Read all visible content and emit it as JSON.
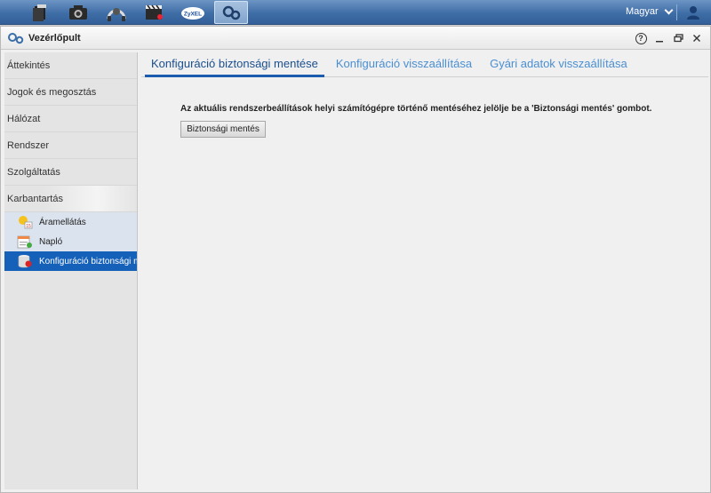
{
  "topbar": {
    "apps": [
      {
        "icon": "file-browser-icon"
      },
      {
        "icon": "photo-camera-icon"
      },
      {
        "icon": "music-icon"
      },
      {
        "icon": "video-icon"
      },
      {
        "icon": "zyxel-cloud-icon",
        "text": "ZyXEL"
      },
      {
        "icon": "control-panel-icon",
        "active": true
      }
    ],
    "language": "Magyar",
    "user_icon": "user-icon"
  },
  "window": {
    "title": "Vezérlőpult",
    "help_glyph": "?"
  },
  "sidebar": {
    "items": [
      {
        "label": "Áttekintés"
      },
      {
        "label": "Jogok és megosztás"
      },
      {
        "label": "Hálózat"
      },
      {
        "label": "Rendszer"
      },
      {
        "label": "Szolgáltatás"
      },
      {
        "label": "Karbantartás",
        "expanded": true
      }
    ],
    "sub_items": [
      {
        "label": "Áramellátás",
        "icon": "power-icon"
      },
      {
        "label": "Napló",
        "icon": "log-icon"
      },
      {
        "label": "Konfiguráció biztonsági mentése",
        "icon": "backup-database-icon",
        "selected": true
      }
    ]
  },
  "main": {
    "tabs": [
      {
        "label": "Konfiguráció biztonsági mentése",
        "active": true
      },
      {
        "label": "Konfiguráció visszaállítása"
      },
      {
        "label": "Gyári adatok visszaállítása"
      }
    ],
    "info_text": "Az aktuális rendszerbeállítások helyi számítógépre történő mentéséhez jelölje be a 'Biztonsági mentés' gombot.",
    "backup_button": "Biztonsági mentés"
  },
  "colors": {
    "topbar": "#3f6da6",
    "selection": "#1560b8",
    "tab_active": "#1b4f8e",
    "tab_inactive": "#4a8fd2"
  }
}
